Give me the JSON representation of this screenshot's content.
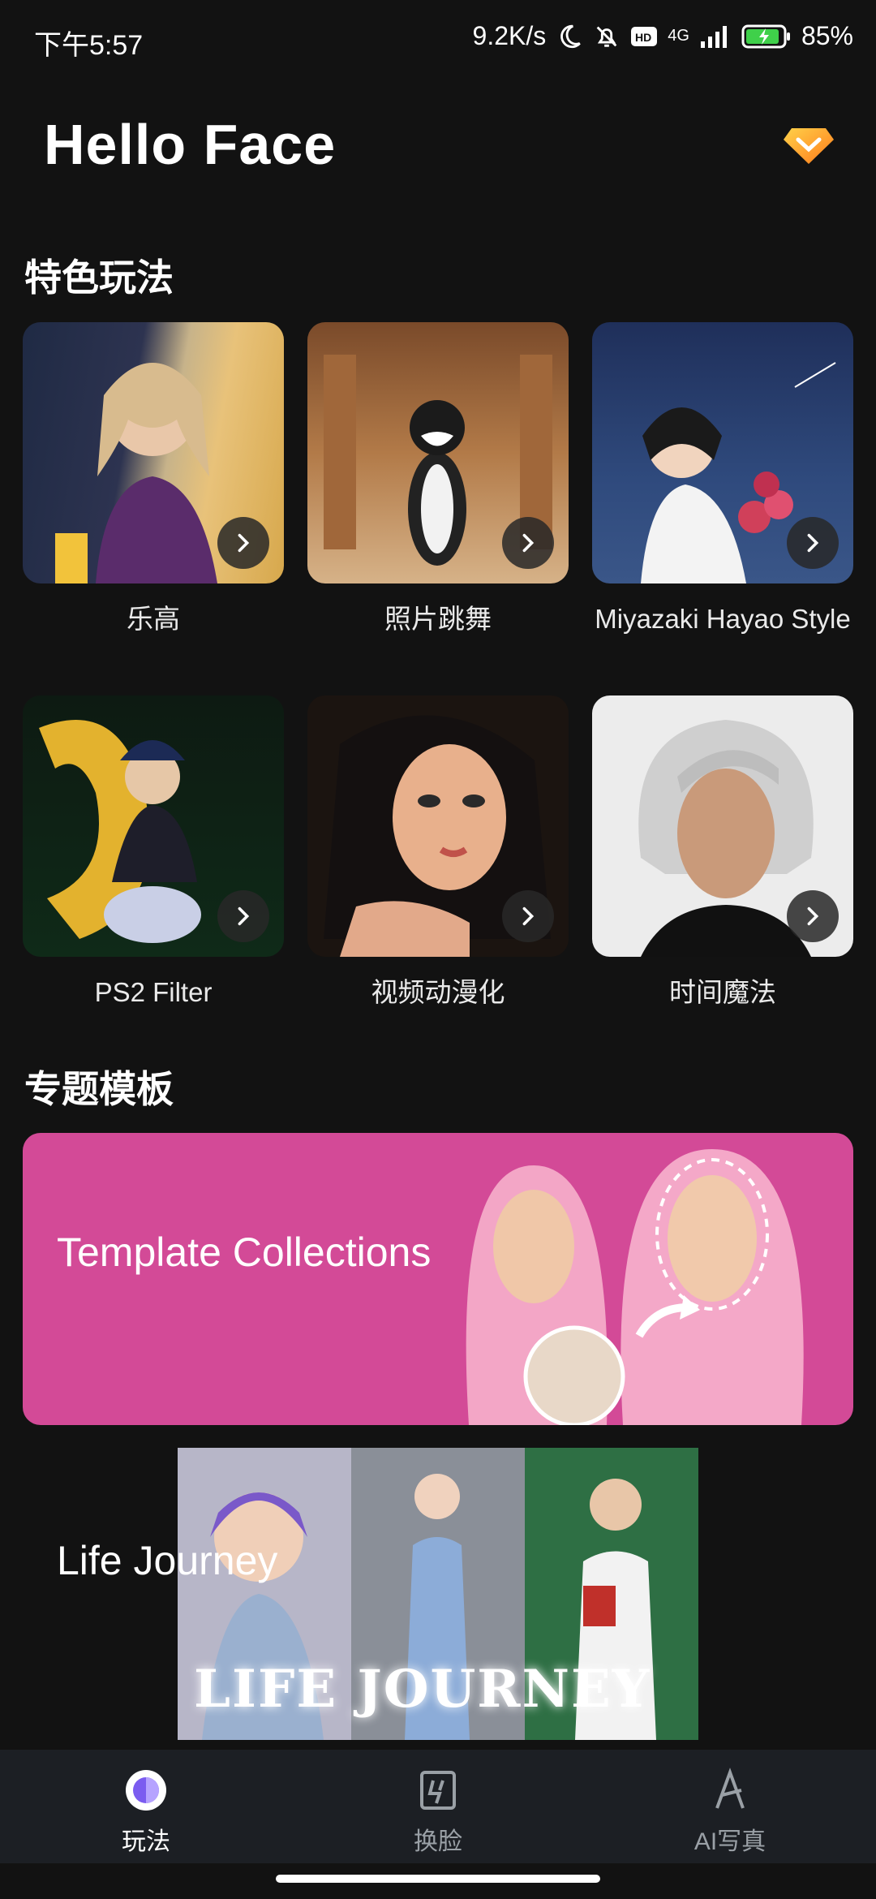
{
  "status_bar": {
    "time": "下午5:57",
    "speed": "9.2K/s",
    "network": "4G",
    "battery": "85%",
    "icons": [
      "moon-icon",
      "bell-muted-icon",
      "hd-icon",
      "signal-icon",
      "battery-icon"
    ]
  },
  "header": {
    "app_title": "Hello Face",
    "premium_icon": "diamond-icon"
  },
  "sections": {
    "features_title": "特色玩法",
    "templates_title": "专题模板"
  },
  "features": [
    {
      "label": "乐高"
    },
    {
      "label": "照片跳舞"
    },
    {
      "label": "Miyazaki Hayao Style"
    },
    {
      "label": "PS2 Filter"
    },
    {
      "label": "视频动漫化"
    },
    {
      "label": "时间魔法"
    }
  ],
  "banners": {
    "template_collections": "Template Collections",
    "life_journey": "Life Journey",
    "life_journey_art_text": "LIFE JOURNEY"
  },
  "bottom_nav": [
    {
      "label": "玩法",
      "active": true,
      "icon": "play-icon"
    },
    {
      "label": "换脸",
      "active": false,
      "icon": "face-swap-icon"
    },
    {
      "label": "AI写真",
      "active": false,
      "icon": "ai-portrait-icon"
    }
  ],
  "colors": {
    "background": "#121212",
    "template_banner": "#d34a97",
    "nav_bg": "#1c1f24",
    "accent_purple": "#7b5cf0"
  }
}
